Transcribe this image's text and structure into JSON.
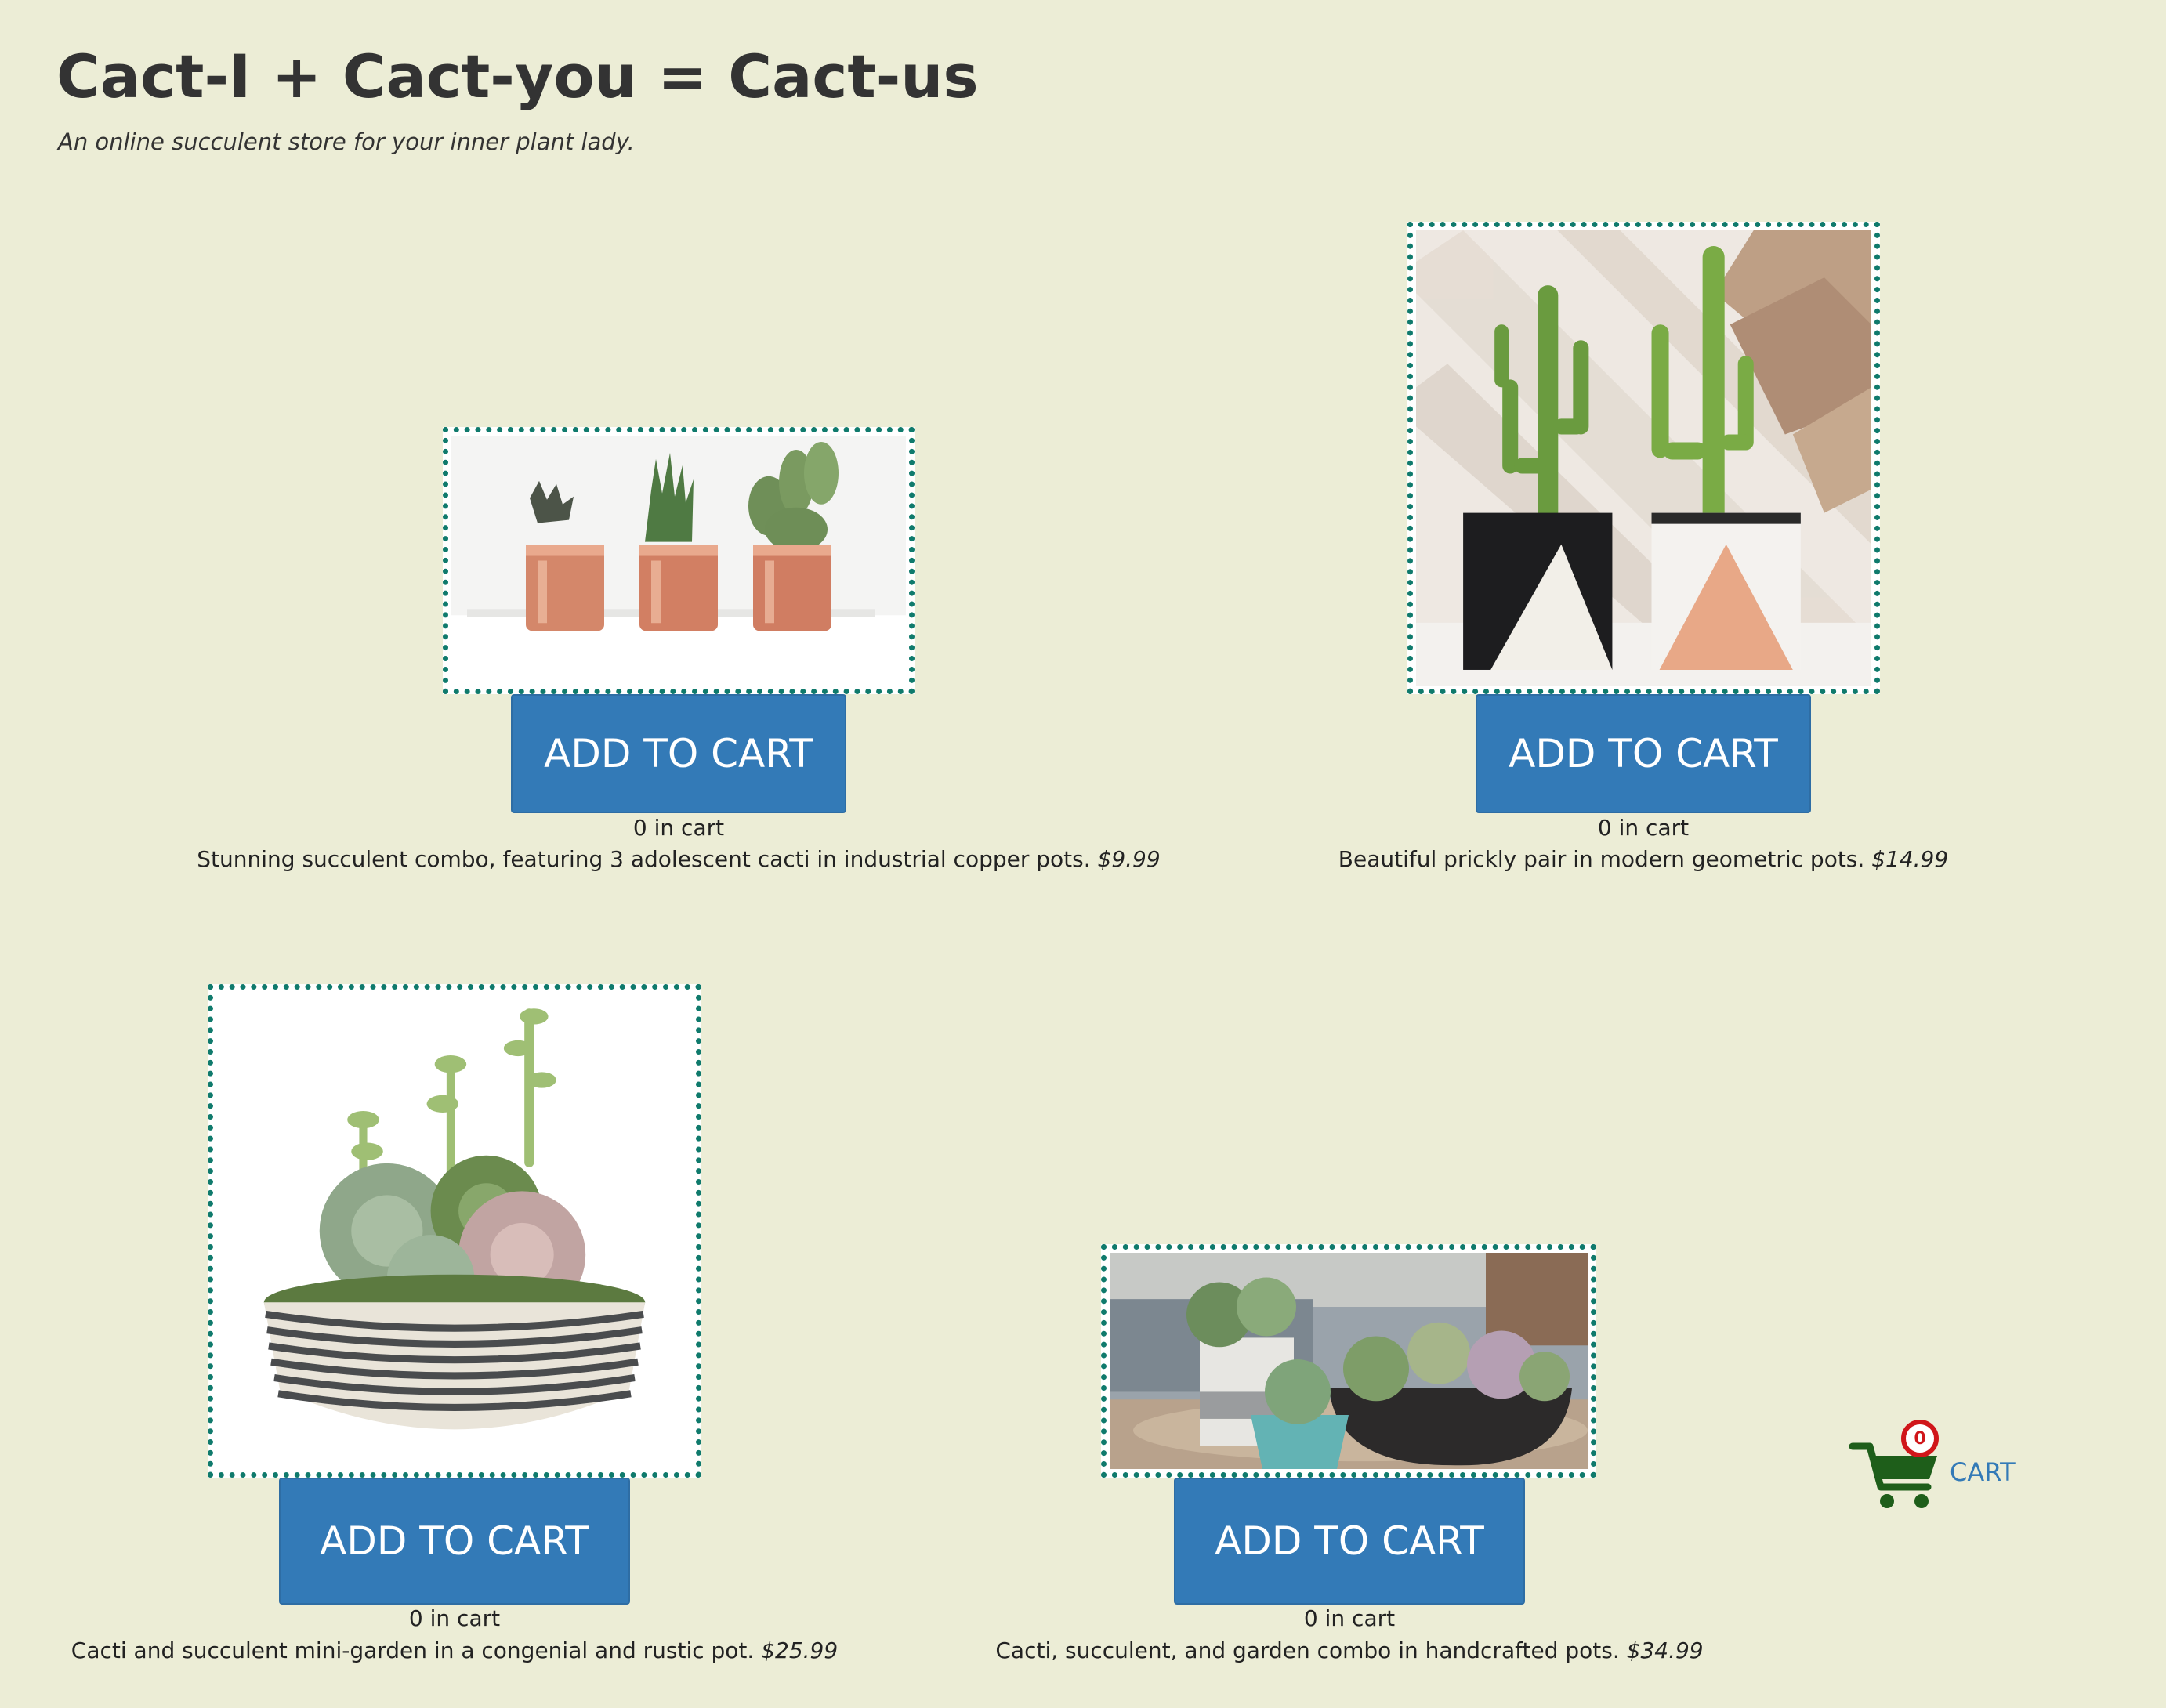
{
  "header": {
    "title": "Cact-I + Cact-you = Cact-us",
    "subtitle": "An online succulent store for your inner plant lady."
  },
  "products": [
    {
      "button_label": "ADD TO CART",
      "count_text": "0 in cart",
      "description": "Stunning succulent combo, featuring 3 adolescent cacti in industrial copper pots.",
      "price": "$9.99"
    },
    {
      "button_label": "ADD TO CART",
      "count_text": "0 in cart",
      "description": "Beautiful prickly pair in modern geometric pots.",
      "price": "$14.99"
    },
    {
      "button_label": "ADD TO CART",
      "count_text": "0 in cart",
      "description": "Cacti and succulent mini-garden in a congenial and rustic pot.",
      "price": "$25.99"
    },
    {
      "button_label": "ADD TO CART",
      "count_text": "0 in cart",
      "description": "Cacti, succulent, and garden combo in handcrafted pots.",
      "price": "$34.99"
    }
  ],
  "cart": {
    "count": "0",
    "label": "CART",
    "icon": "shopping-cart-icon"
  },
  "colors": {
    "background": "#ecedd6",
    "button": "#337ab7",
    "frame_border": "#0f7a6c",
    "cart_icon": "#1e5e1a",
    "badge": "#d0161a"
  }
}
